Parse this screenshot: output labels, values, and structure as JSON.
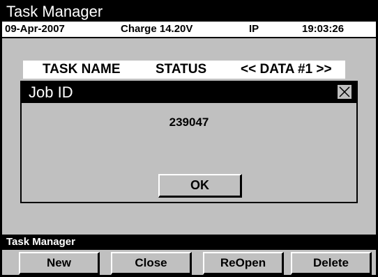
{
  "app": {
    "title": "Task Manager"
  },
  "status": {
    "date": "09-Apr-2007",
    "charge": "Charge 14.20V",
    "mode": "IP",
    "time": "19:03:26"
  },
  "table": {
    "columns": [
      "TASK NAME",
      "STATUS",
      "<< DATA #1 >>"
    ]
  },
  "dialog": {
    "title": "Job ID",
    "value": "239047",
    "ok_label": "OK"
  },
  "footer": {
    "title": "Task Manager",
    "buttons": [
      "New",
      "Close",
      "ReOpen",
      "Delete"
    ]
  }
}
